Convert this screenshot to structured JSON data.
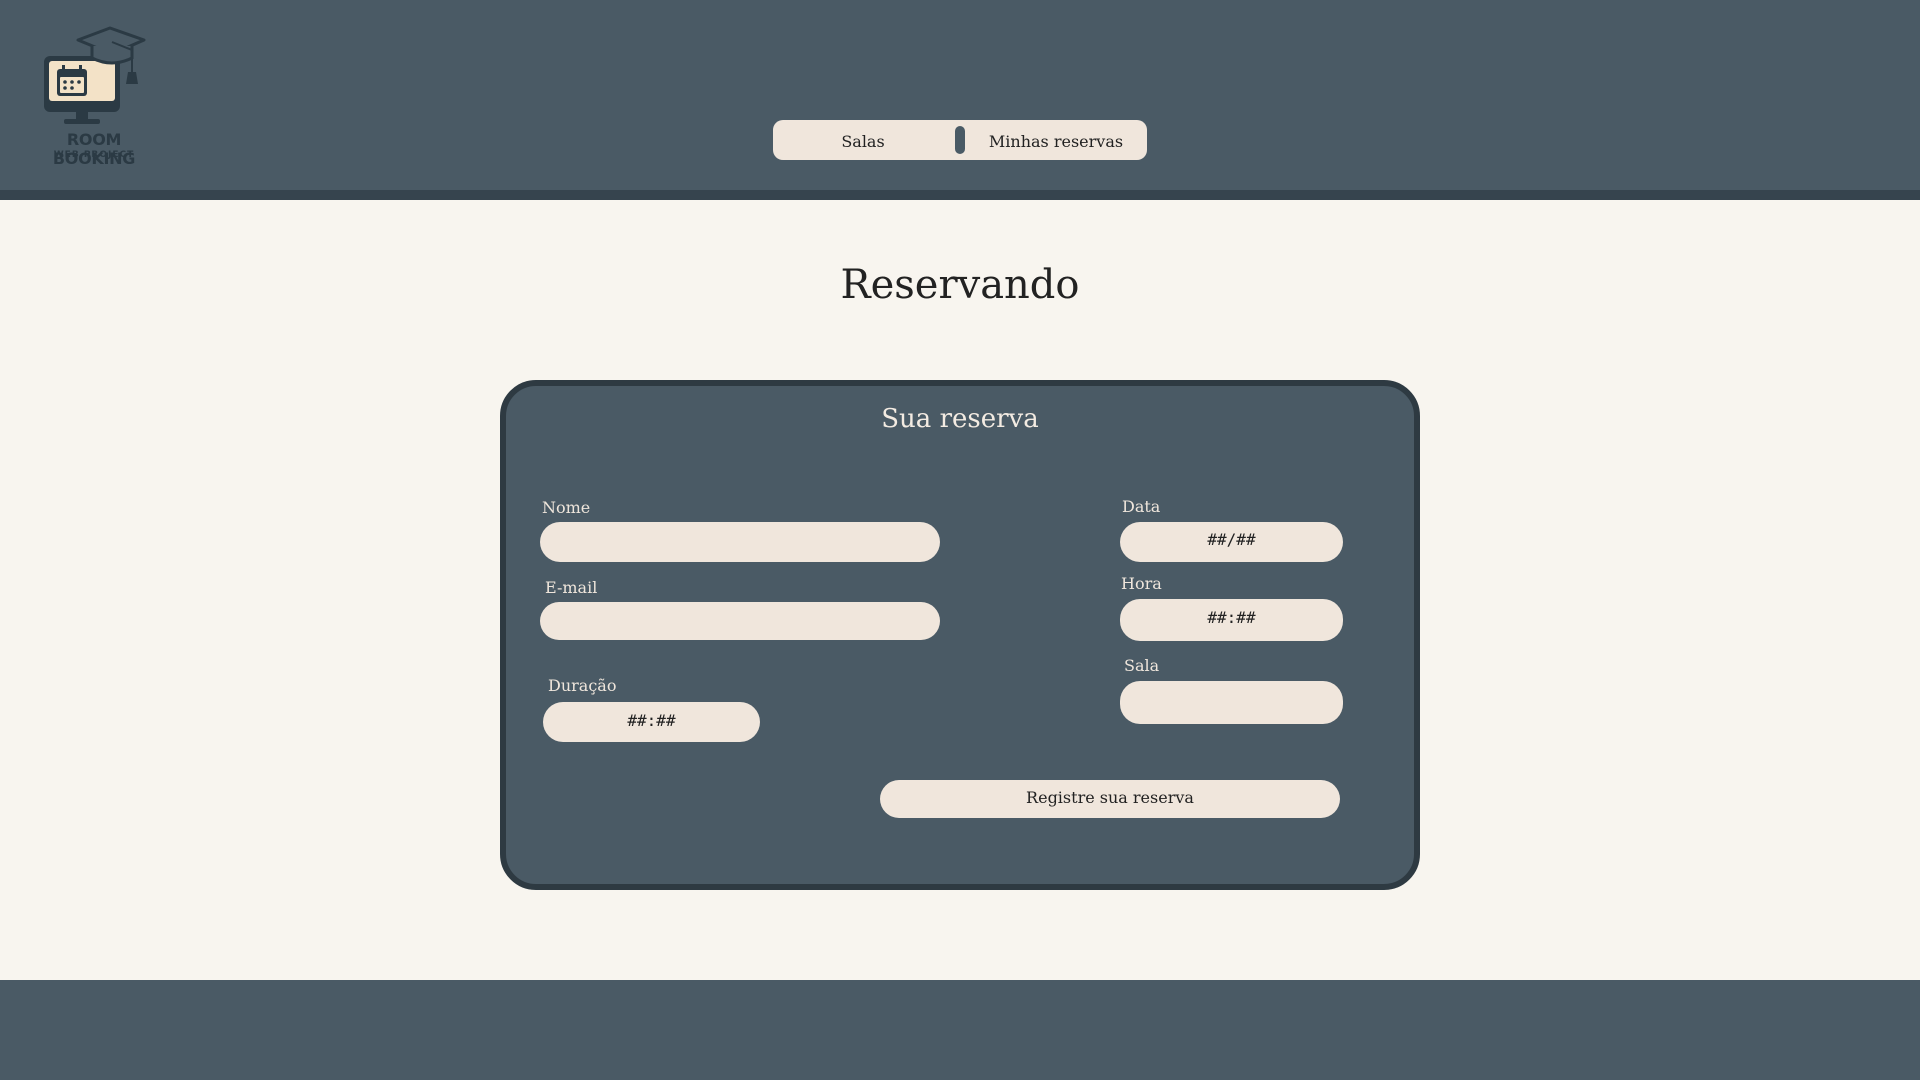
{
  "header": {
    "logo": {
      "title": "ROOM BOOKING",
      "subtitle": "WEB PROJECT"
    },
    "nav": {
      "salas": "Salas",
      "minhas_reservas": "Minhas reservas"
    }
  },
  "main": {
    "title": "Reservando",
    "form": {
      "title": "Sua reserva",
      "nome": {
        "label": "Nome",
        "value": ""
      },
      "email": {
        "label": "E-mail",
        "value": ""
      },
      "duracao": {
        "label": "Duração",
        "value": "##:##"
      },
      "data": {
        "label": "Data",
        "value": "##/##"
      },
      "hora": {
        "label": "Hora",
        "value": "##:##"
      },
      "sala": {
        "label": "Sala",
        "value": ""
      },
      "submit_label": "Registre sua reserva"
    }
  },
  "colors": {
    "header_bg": "#4a5a65",
    "page_bg": "#f8f5ef",
    "field_bg": "#f0e6dc",
    "card_border": "#2e3a42"
  }
}
